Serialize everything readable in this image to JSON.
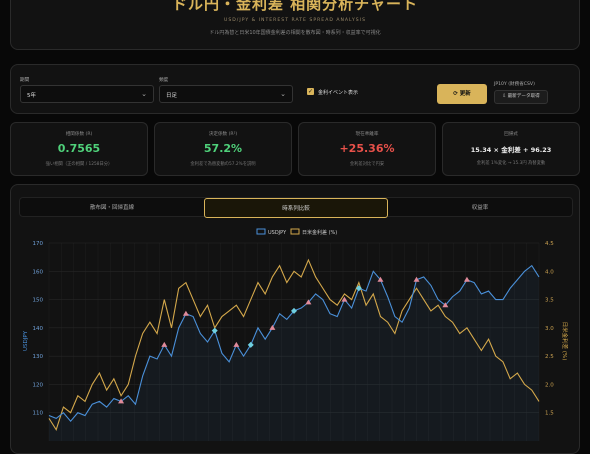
{
  "header": {
    "title": "ドル円・金利差 相関分析チャート",
    "subtitle": "USD/JPY & INTEREST RATE SPREAD ANALYSIS",
    "description": "ドル円為替と日米10年国債金利差の相関を散布図・時系列・収益率で可視化"
  },
  "controls": {
    "period_label": "期間",
    "period_value": "5年",
    "freq_label": "頻度",
    "freq_value": "日足",
    "event_label": "金利イベント表示",
    "event_checked": true,
    "update_label": "更新",
    "csv_label": "JP10Y (財務省CSV)",
    "fetch_label": "最新データ取得"
  },
  "cards": [
    {
      "title": "相関係数 (R)",
      "value": "0.7565",
      "sub": "強い相関（正の相関 / 1258日分）",
      "color": "#4fd17a"
    },
    {
      "title": "決定係数 (R²)",
      "value": "57.2%",
      "sub": "金利差で為替変動の57.2%を説明",
      "color": "#4fd17a"
    },
    {
      "title": "現在乖離率",
      "value": "+25.36%",
      "sub": "金利差対比で円安",
      "color": "#e8514a"
    },
    {
      "title": "回帰式",
      "value": "15.34 × 金利差 + 96.23",
      "sub": "金利差 1%変化 → 15.3円 為替変動",
      "color": "#eeeeee"
    }
  ],
  "tabs": [
    {
      "label": "散布図・回帰直線",
      "active": false
    },
    {
      "label": "時系列比較",
      "active": true
    },
    {
      "label": "収益率",
      "active": false
    }
  ],
  "chart_data": {
    "type": "line",
    "legend": [
      "USDJPY",
      "日米金利差 (%)"
    ],
    "ylabel_left": "USDJPY",
    "ylabel_right": "日米金利差 (%)",
    "ylim_left": [
      100,
      170
    ],
    "ylim_right": [
      1.0,
      4.5
    ],
    "yticks_left": [
      110,
      120,
      130,
      140,
      150,
      160,
      170
    ],
    "yticks_right": [
      1.5,
      2.0,
      2.5,
      3.0,
      3.5,
      4.0,
      4.5
    ],
    "legend_position": "top-center",
    "grid": true,
    "colors": {
      "usdjpy": "#4a90d9",
      "spread": "#d4a84b",
      "event_up": "#e08a9a",
      "event_down": "#6fd0e0"
    },
    "series": [
      {
        "name": "USDJPY",
        "axis": "left",
        "values": [
          109,
          108,
          110,
          107,
          110,
          109,
          113,
          114,
          112,
          115,
          114,
          116,
          113,
          123,
          130,
          129,
          134,
          130,
          140,
          145,
          144,
          138,
          135,
          139,
          131,
          128,
          134,
          130,
          134,
          140,
          136,
          140,
          145,
          143,
          146,
          147,
          149,
          152,
          150,
          145,
          144,
          150,
          147,
          154,
          153,
          160,
          157,
          151,
          144,
          142,
          147,
          157,
          158,
          155,
          150,
          148,
          151,
          153,
          157,
          156,
          152,
          153,
          150,
          150,
          154,
          157,
          160,
          162,
          158
        ]
      },
      {
        "name": "日米金利差 (%)",
        "axis": "right",
        "values": [
          1.4,
          1.2,
          1.6,
          1.5,
          1.8,
          1.7,
          2.0,
          2.2,
          1.9,
          2.1,
          1.8,
          2.0,
          2.5,
          2.9,
          3.1,
          2.9,
          3.5,
          3.0,
          3.7,
          3.8,
          3.5,
          3.2,
          3.4,
          3.0,
          3.2,
          3.3,
          3.4,
          3.2,
          3.5,
          3.8,
          3.6,
          3.9,
          4.1,
          3.8,
          4.0,
          3.9,
          4.2,
          3.9,
          3.7,
          3.5,
          3.4,
          3.6,
          3.5,
          3.8,
          3.4,
          3.6,
          3.2,
          3.1,
          2.9,
          3.3,
          3.5,
          3.7,
          3.5,
          3.3,
          3.4,
          3.2,
          3.1,
          2.9,
          3.0,
          2.8,
          2.6,
          2.8,
          2.5,
          2.4,
          2.1,
          2.2,
          2.0,
          1.9,
          1.7
        ]
      }
    ],
    "events": [
      {
        "index": 10,
        "type": "up"
      },
      {
        "index": 16,
        "type": "up"
      },
      {
        "index": 19,
        "type": "up"
      },
      {
        "index": 23,
        "type": "down"
      },
      {
        "index": 26,
        "type": "up"
      },
      {
        "index": 28,
        "type": "down"
      },
      {
        "index": 31,
        "type": "up"
      },
      {
        "index": 34,
        "type": "down"
      },
      {
        "index": 36,
        "type": "up"
      },
      {
        "index": 41,
        "type": "up"
      },
      {
        "index": 43,
        "type": "down"
      },
      {
        "index": 46,
        "type": "up"
      },
      {
        "index": 51,
        "type": "up"
      },
      {
        "index": 55,
        "type": "up"
      },
      {
        "index": 58,
        "type": "up"
      }
    ]
  }
}
